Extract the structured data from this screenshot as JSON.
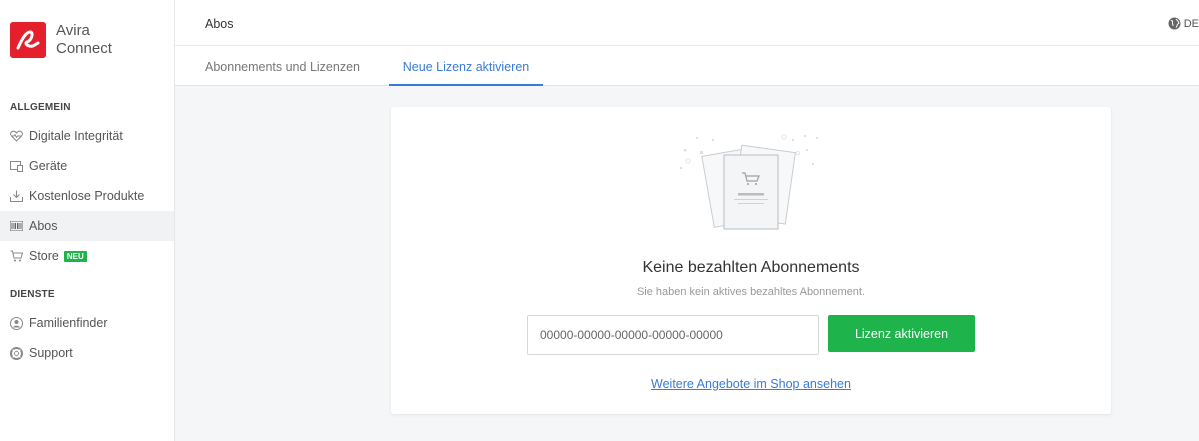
{
  "brand": {
    "line1": "Avira",
    "line2": "Connect",
    "color": "#e4202d"
  },
  "sidebar": {
    "sections": [
      {
        "title": "ALLGEMEIN",
        "items": [
          {
            "label": "Digitale Integrität",
            "icon": "heart-pulse-icon"
          },
          {
            "label": "Geräte",
            "icon": "devices-icon"
          },
          {
            "label": "Kostenlose Produkte",
            "icon": "download-icon"
          },
          {
            "label": "Abos",
            "icon": "barcode-icon",
            "active": true
          },
          {
            "label": "Store",
            "icon": "cart-icon",
            "badge": "NEU"
          }
        ]
      },
      {
        "title": "DIENSTE",
        "items": [
          {
            "label": "Familienfinder",
            "icon": "family-icon"
          },
          {
            "label": "Support",
            "icon": "lifebuoy-icon"
          }
        ]
      }
    ]
  },
  "header": {
    "title": "Abos",
    "language": "DE"
  },
  "tabs": [
    {
      "label": "Abonnements und Lizenzen",
      "active": false
    },
    {
      "label": "Neue Lizenz aktivieren",
      "active": true
    }
  ],
  "card": {
    "title": "Keine bezahlten Abonnements",
    "subtitle": "Sie haben kein aktives bezahltes Abonnement.",
    "input_placeholder": "00000-00000-00000-00000-00000",
    "activate_label": "Lizenz aktivieren",
    "shop_link": "Weitere Angebote im Shop ansehen"
  },
  "colors": {
    "accent": "#3a7bd5",
    "success": "#1fb34c",
    "brand": "#e4202d"
  }
}
